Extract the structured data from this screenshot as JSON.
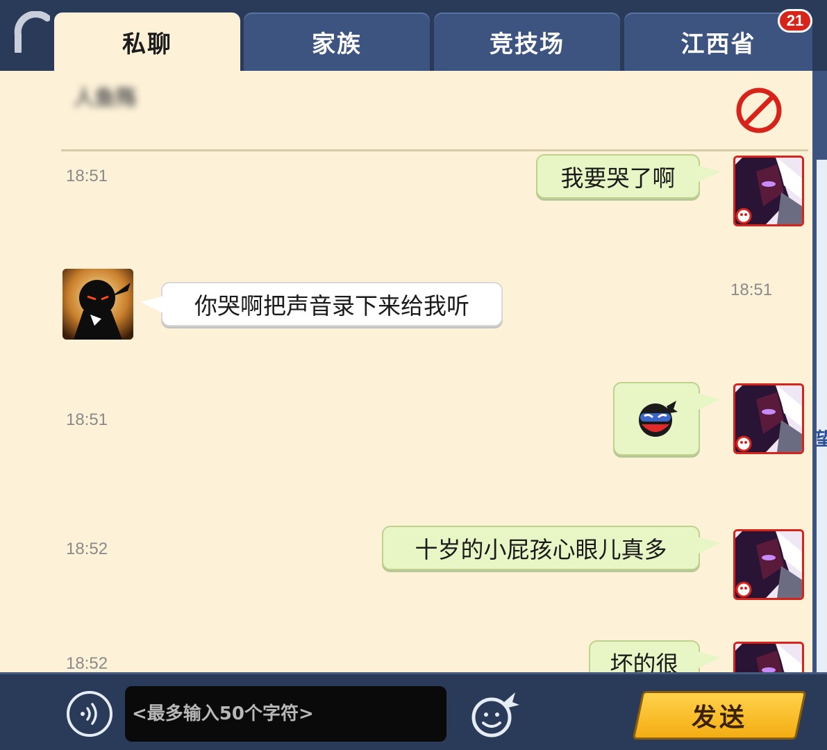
{
  "tabs": [
    {
      "label": "私聊",
      "active": true
    },
    {
      "label": "家族",
      "active": false
    },
    {
      "label": "竞技场",
      "active": false
    },
    {
      "label": "江西省",
      "active": false
    }
  ],
  "badge_count": "21",
  "header": {
    "partner_name": "人鱼殇"
  },
  "messages": [
    {
      "time": "18:51",
      "side": "self",
      "text": "我要哭了啊"
    },
    {
      "time": "18:51",
      "side": "other",
      "text": "你哭啊把声音录下来给我听"
    },
    {
      "time": "18:51",
      "side": "self",
      "text": "",
      "sticker": "ninja-face-sticker"
    },
    {
      "time": "18:52",
      "side": "self",
      "text": "十岁的小屁孩心眼儿真多"
    },
    {
      "time": "18:52",
      "side": "self",
      "text": "坏的很"
    }
  ],
  "input": {
    "placeholder": "<最多输入50个字符>"
  },
  "send_label": "发送",
  "right_rail_char": "望",
  "icons": {
    "back": "back-arc-icon",
    "block": "block-icon",
    "voice": "voice-icon",
    "emoji": "emoji-icon"
  },
  "colors": {
    "panel_bg": "#fdf1d8",
    "self_bubble": "#e8f5c4",
    "other_bubble": "#ffffff",
    "tab_inactive": "#3d5480",
    "send_button": "#f4ad14",
    "block_red": "#d8231b"
  }
}
